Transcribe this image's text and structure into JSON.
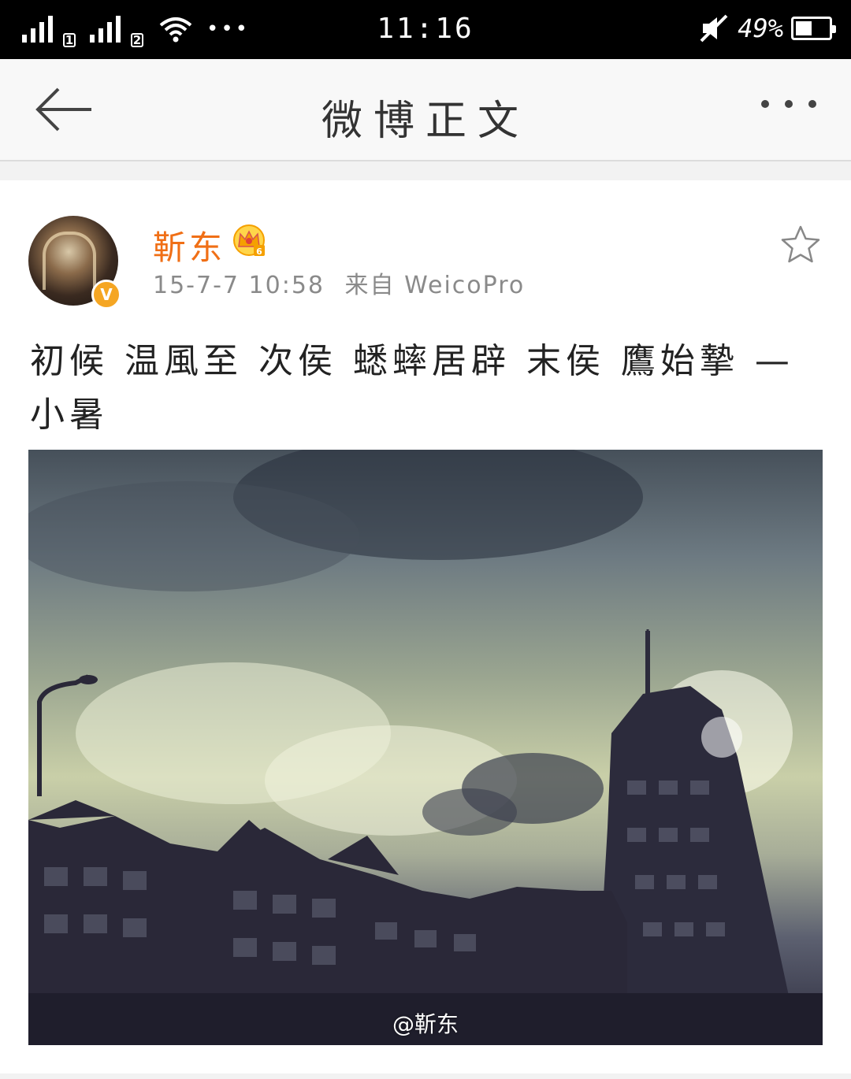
{
  "status_bar": {
    "sim1": "1",
    "sim2": "2",
    "more_indicator": "•••",
    "time": "11:16",
    "battery_percent_text": "49%",
    "battery_level": 0.49
  },
  "nav": {
    "title": "微博正文"
  },
  "post": {
    "username": "靳东",
    "vip_level": "6",
    "verified_badge": "V",
    "timestamp": "15-7-7 10:58",
    "source": "来自 WeicoPro",
    "text": "初候 温風至  次侯 蟋蟀居辟  末侯 鷹始摯 — 小暑",
    "image_watermark": "@靳东"
  },
  "colors": {
    "username": "#f06f16",
    "verified": "#f5a623",
    "crown": "#f5b400"
  }
}
